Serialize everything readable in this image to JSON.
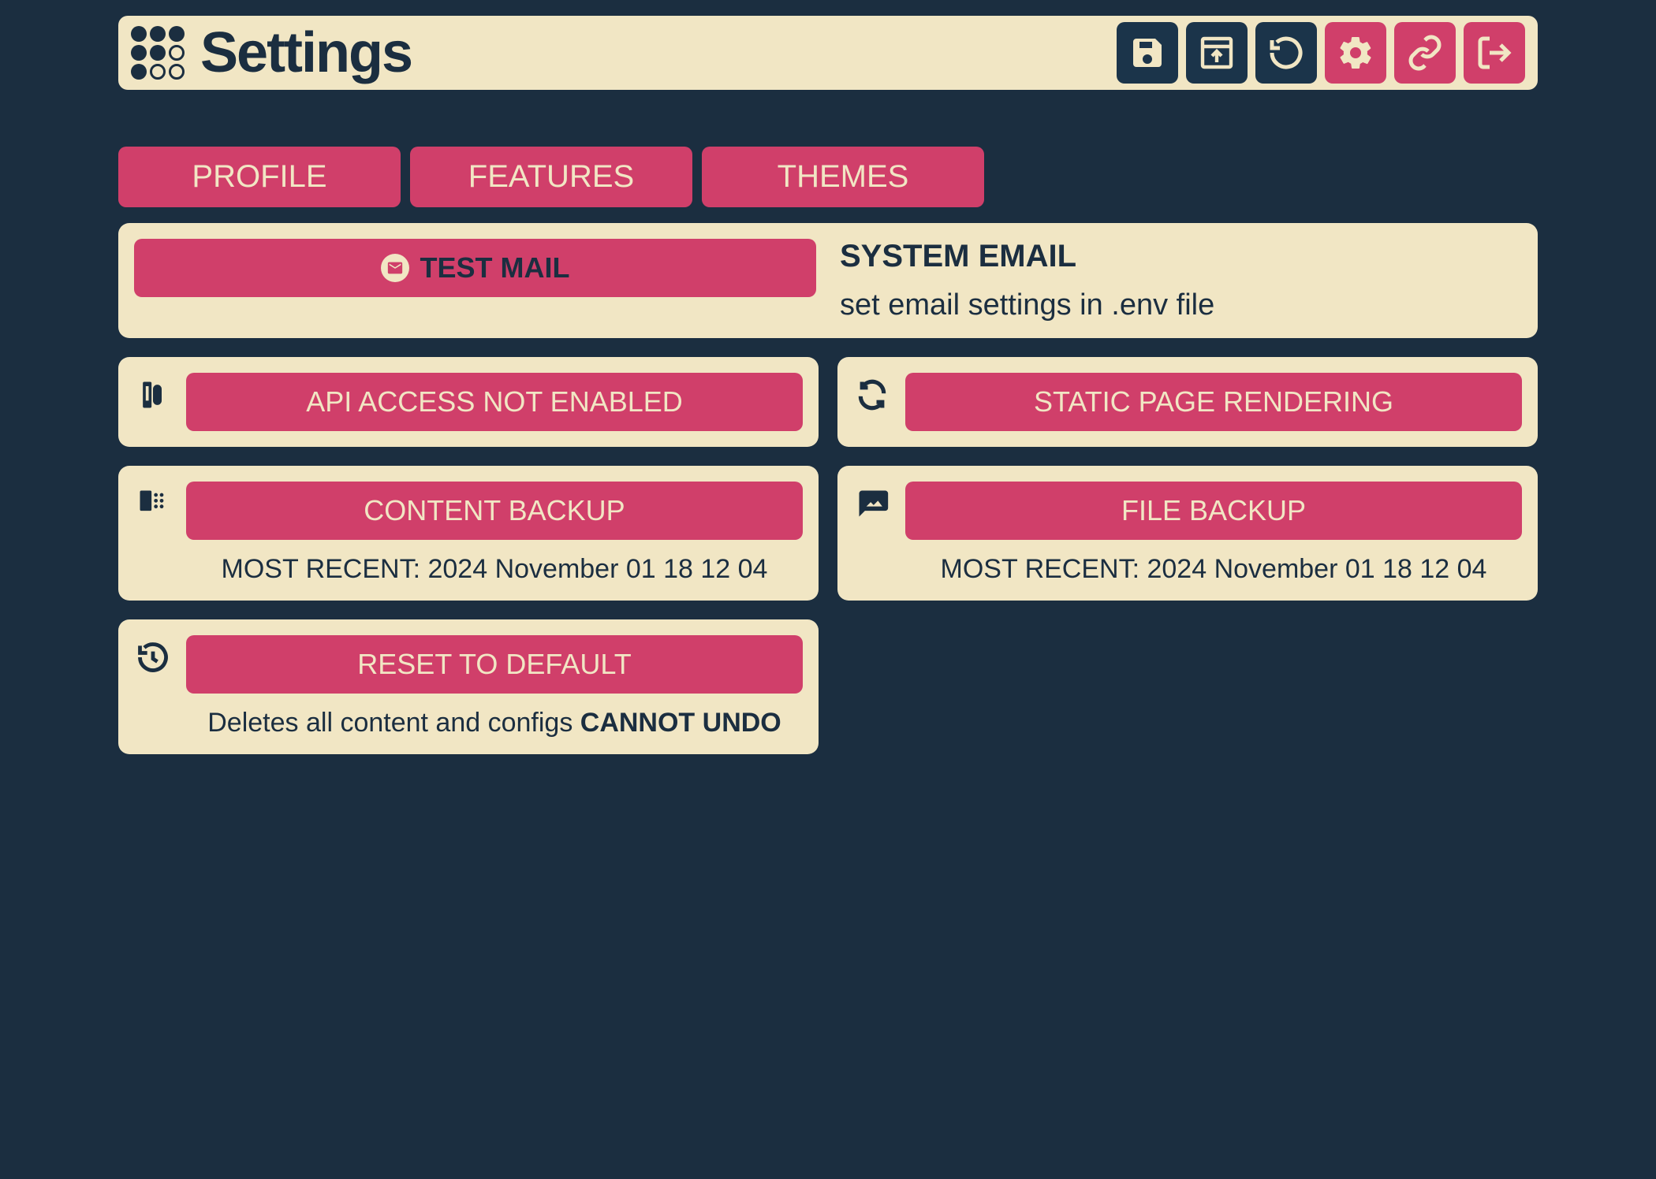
{
  "header": {
    "title": "Settings"
  },
  "tabs": {
    "profile": "PROFILE",
    "features": "FEATURES",
    "themes": "THEMES"
  },
  "email": {
    "button": "TEST MAIL",
    "heading": "SYSTEM EMAIL",
    "subtext": "set email settings in .env file"
  },
  "api": {
    "button": "API ACCESS NOT ENABLED"
  },
  "static": {
    "button": "STATIC PAGE RENDERING"
  },
  "content_backup": {
    "button": "CONTENT BACKUP",
    "caption_prefix": "MOST RECENT: ",
    "caption_value": "2024 November 01 18 12 04"
  },
  "file_backup": {
    "button": "FILE BACKUP",
    "caption_prefix": "MOST RECENT: ",
    "caption_value": "2024 November 01 18 12 04"
  },
  "reset": {
    "button": "RESET TO DEFAULT",
    "caption_text": "Deletes all content and configs ",
    "caption_strong": "CANNOT UNDO"
  }
}
